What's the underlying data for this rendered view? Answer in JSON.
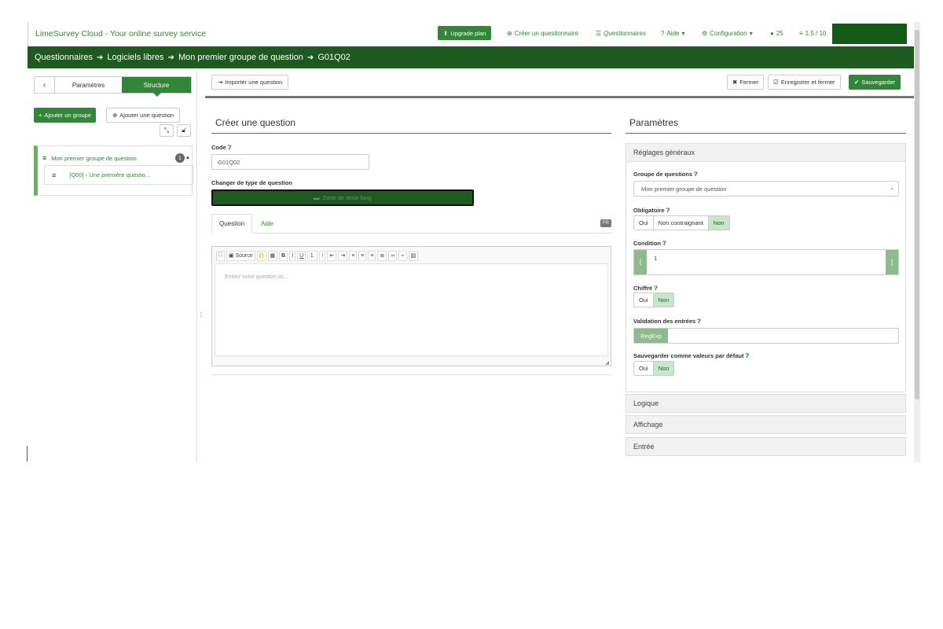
{
  "header": {
    "brand": "LimeSurvey Cloud - Your online survey service",
    "upgrade_label": "Upgrade plan",
    "create_survey": "Créer un questionnaire",
    "surveys": "Questionnaires",
    "help": "Aide",
    "configuration": "Configuration",
    "notifications_count": "25",
    "storage": "1.5 / 10"
  },
  "breadcrumb": {
    "items": [
      "Questionnaires",
      "Logiciels libres",
      "Mon premier groupe de question",
      "G01Q02"
    ]
  },
  "sidebar": {
    "tab_params": "Paramètres",
    "tab_structure": "Structure",
    "add_group": "Ajouter un groupe",
    "add_question": "Ajouter une question",
    "group_label": "Mon premier groupe de question",
    "group_count": "1",
    "question_label": "[Q00] › Une première questio..."
  },
  "toolbar": {
    "import_label": "Importer une question",
    "close_label": "Fermer",
    "save_close_label": "Enregistrer et fermer",
    "save_label": "Sauvegarder"
  },
  "form": {
    "title": "Créer une question",
    "code_label": "Code",
    "code_value": "G01Q02",
    "type_label": "Changer de type de question",
    "type_value": "Zone de texte long",
    "tab_question": "Question",
    "tab_help": "Aide",
    "lang": "FR",
    "editor_source": "Source",
    "editor_placeholder": "Entrez votre question ici..."
  },
  "params": {
    "title": "Paramètres",
    "general_header": "Réglages généraux",
    "group_label": "Groupe de questions",
    "group_value": "Mon premier groupe de question",
    "mandatory_label": "Obligatoire",
    "mandatory_options": [
      "Oui",
      "Non contraignant",
      "Non"
    ],
    "mandatory_selected": "Non",
    "condition_label": "Condition",
    "condition_value": "1",
    "encrypted_label": "Chiffré",
    "encrypted_options": [
      "Oui",
      "Non"
    ],
    "validation_label": "Validation des entrées",
    "regexp_label": "RegExp",
    "default_label": "Sauvegarder comme valeurs par défaut",
    "default_options": [
      "Oui",
      "Non"
    ],
    "sections": [
      "Logique",
      "Affichage",
      "Entrée"
    ]
  },
  "colors": {
    "accent": "#328637",
    "breadcrumb_bg": "#1e5a1f",
    "selected_segment": "#c8e6c9"
  }
}
